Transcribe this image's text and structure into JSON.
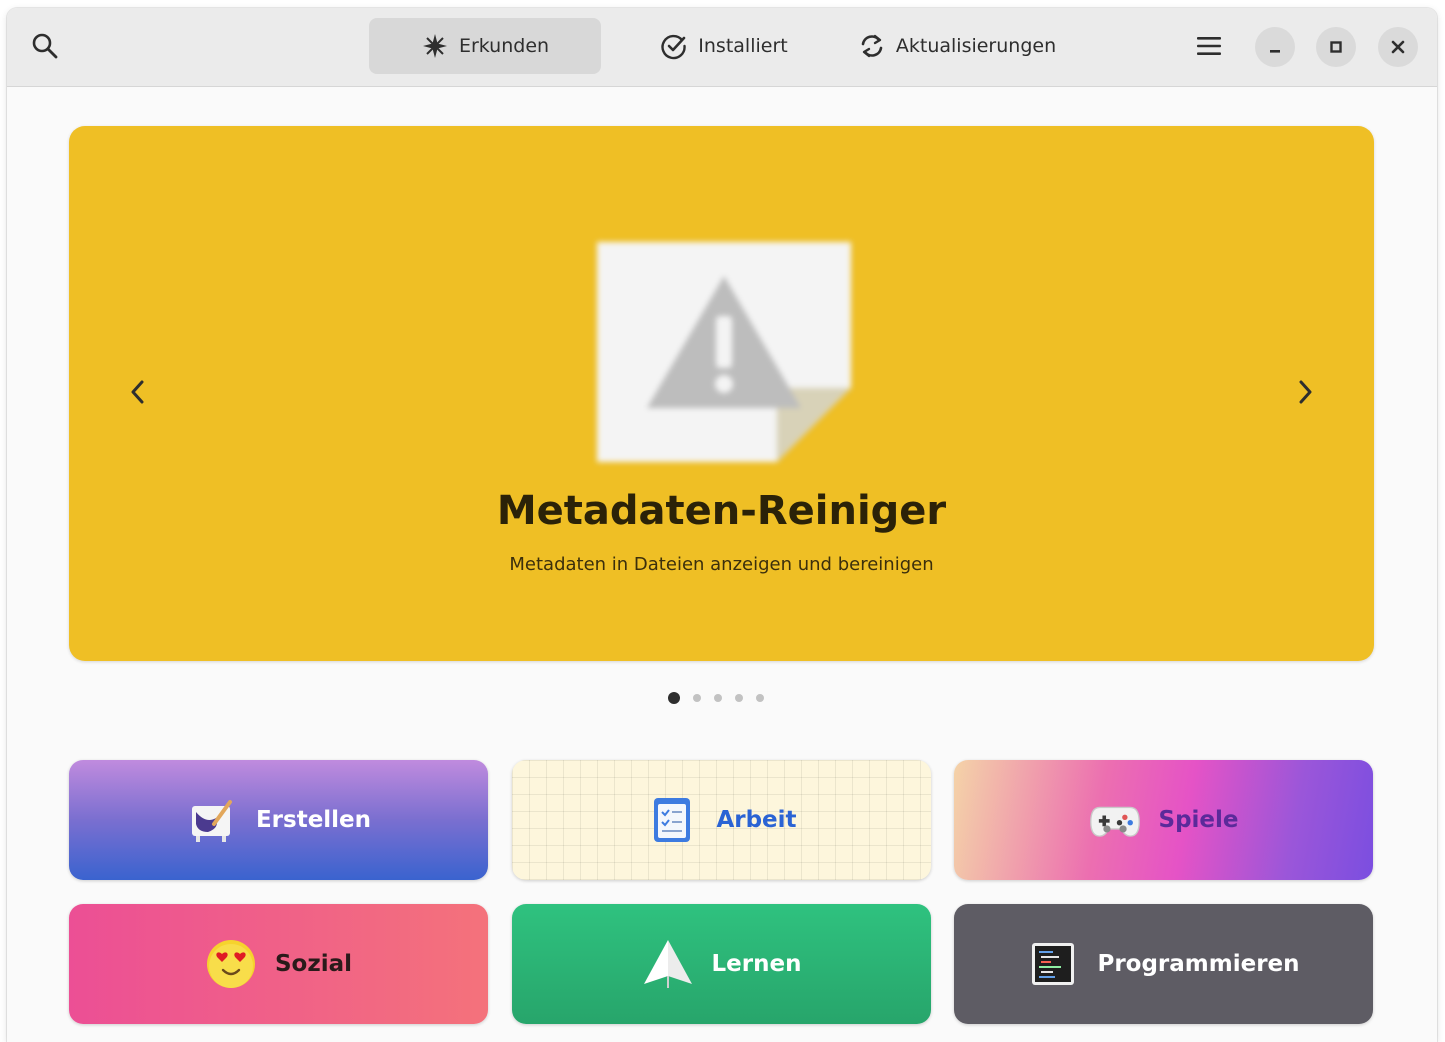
{
  "header": {
    "tabs": [
      {
        "label": "Erkunden",
        "icon": "explore-icon",
        "active": true
      },
      {
        "label": "Installiert",
        "icon": "check-circle-icon",
        "active": false
      },
      {
        "label": "Aktualisierungen",
        "icon": "refresh-icon",
        "active": false
      }
    ],
    "icons": [
      "search-icon",
      "hamburger-menu-icon",
      "minimize-icon",
      "maximize-icon",
      "close-icon"
    ]
  },
  "featured": {
    "title": "Metadaten-Reiniger",
    "subtitle": "Metadaten in Dateien anzeigen und bereinigen",
    "background": "#efbf25",
    "icon": "missing-image-icon",
    "pages": 5,
    "current_page": 1
  },
  "categories": [
    {
      "label": "Erstellen",
      "icon": "paint-canvas-icon"
    },
    {
      "label": "Arbeit",
      "icon": "checklist-icon"
    },
    {
      "label": "Spiele",
      "icon": "gamepad-icon"
    },
    {
      "label": "Sozial",
      "icon": "heart-eyes-emoji-icon"
    },
    {
      "label": "Lernen",
      "icon": "paper-plane-icon"
    },
    {
      "label": "Programmieren",
      "icon": "terminal-icon"
    }
  ],
  "colors": {
    "accent_work": "#2a63d4",
    "games_text": "#5b2a9a"
  }
}
